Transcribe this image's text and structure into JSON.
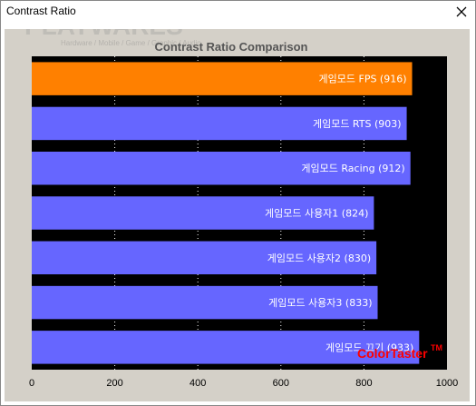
{
  "window": {
    "title": "Contrast Ratio",
    "close_icon": "close-icon"
  },
  "watermark": {
    "brand": "PLAYWARES",
    "tagline": "Hardware / Mobile / Game / Graphic / Audio"
  },
  "colortaster": {
    "text": "ColorTaster",
    "tm": "TM"
  },
  "colors": {
    "highlight": "#ff8000",
    "bar": "#6666ff",
    "plot_bg": "#000000",
    "panel_bg": "#d4d0c8",
    "grid": "#ffffff",
    "colortaster": "#ff0000"
  },
  "chart_data": {
    "type": "bar",
    "orientation": "horizontal",
    "title": "Contrast Ratio Comparison",
    "categories": [
      "게임모드 FPS (916)",
      "게임모드 RTS (903)",
      "게임모드 Racing (912)",
      "게임모드 사용자1 (824)",
      "게임모드 사용자2 (830)",
      "게임모드 사용자3 (833)",
      "게임모드 끄기 (933)"
    ],
    "values": [
      916,
      903,
      912,
      824,
      830,
      833,
      933
    ],
    "highlight_index": 0,
    "xlim": [
      0,
      1000
    ],
    "xticks": [
      "0",
      "200",
      "400",
      "600",
      "800",
      "1000"
    ],
    "grid": true
  }
}
